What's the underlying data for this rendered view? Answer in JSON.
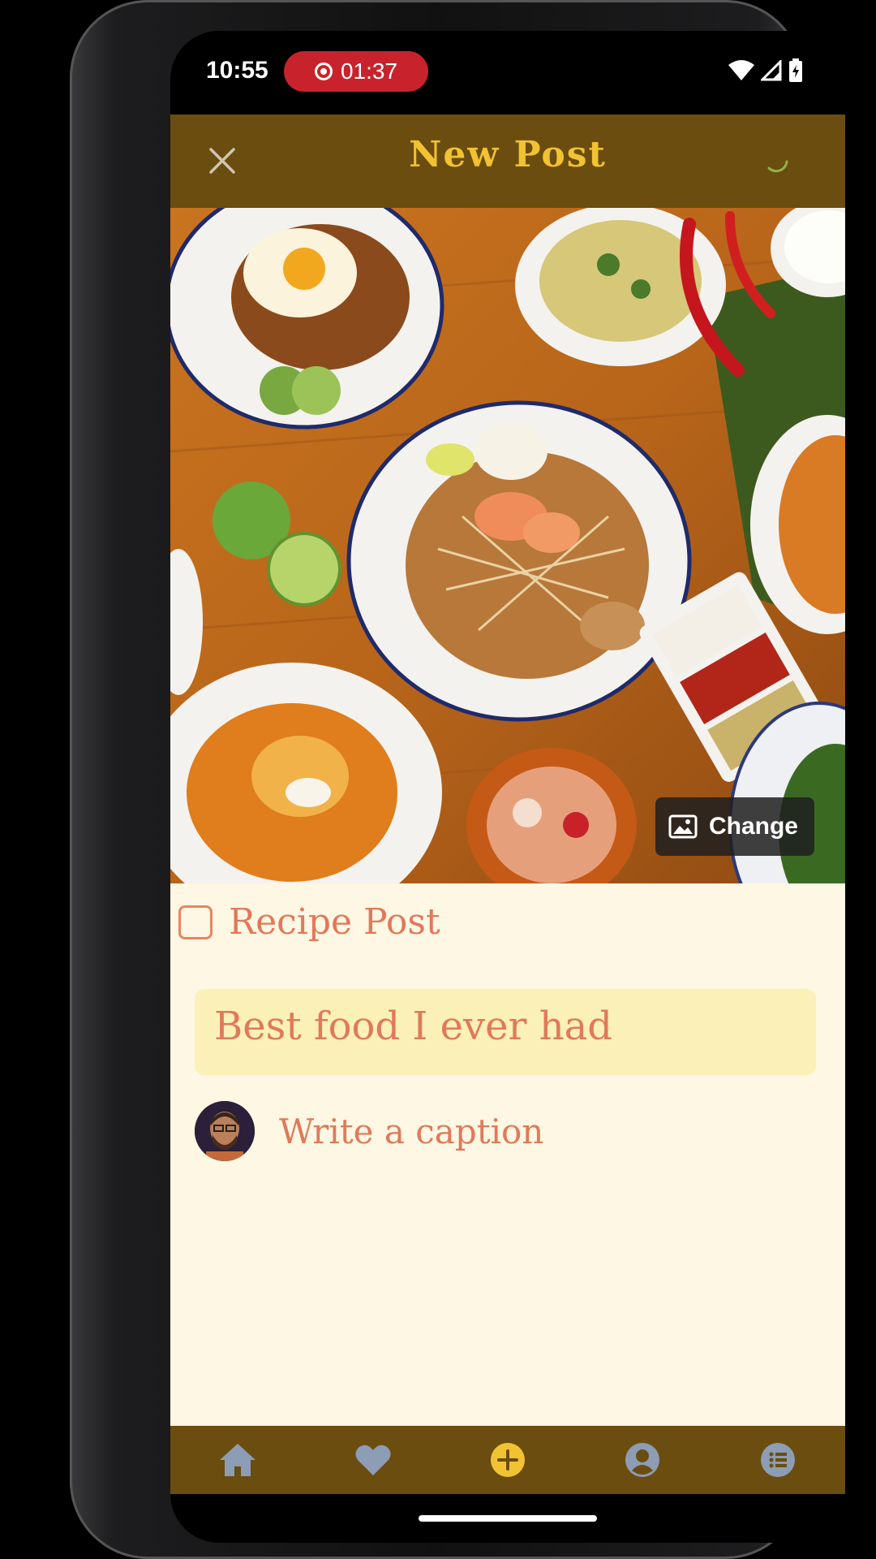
{
  "status_bar": {
    "time": "10:55",
    "recording_time": "01:37"
  },
  "app_bar": {
    "title": "New Post",
    "close_icon": "close-icon",
    "loading_icon": "spinner-icon"
  },
  "photo": {
    "description_icon": "image-icon",
    "change_label": "Change"
  },
  "form": {
    "recipe_label": "Recipe Post",
    "recipe_checked": false,
    "title_value": "Best food I ever had",
    "caption_placeholder": "Write a caption"
  },
  "bottom_nav": {
    "items": [
      {
        "icon": "home-icon",
        "active": false
      },
      {
        "icon": "heart-icon",
        "active": false
      },
      {
        "icon": "add-icon",
        "active": true
      },
      {
        "icon": "profile-icon",
        "active": false
      },
      {
        "icon": "list-icon",
        "active": false
      }
    ]
  },
  "colors": {
    "bar": "#6b4d10",
    "accent": "#f1c232",
    "text": "#e0795a",
    "background": "#fdf7e3"
  }
}
